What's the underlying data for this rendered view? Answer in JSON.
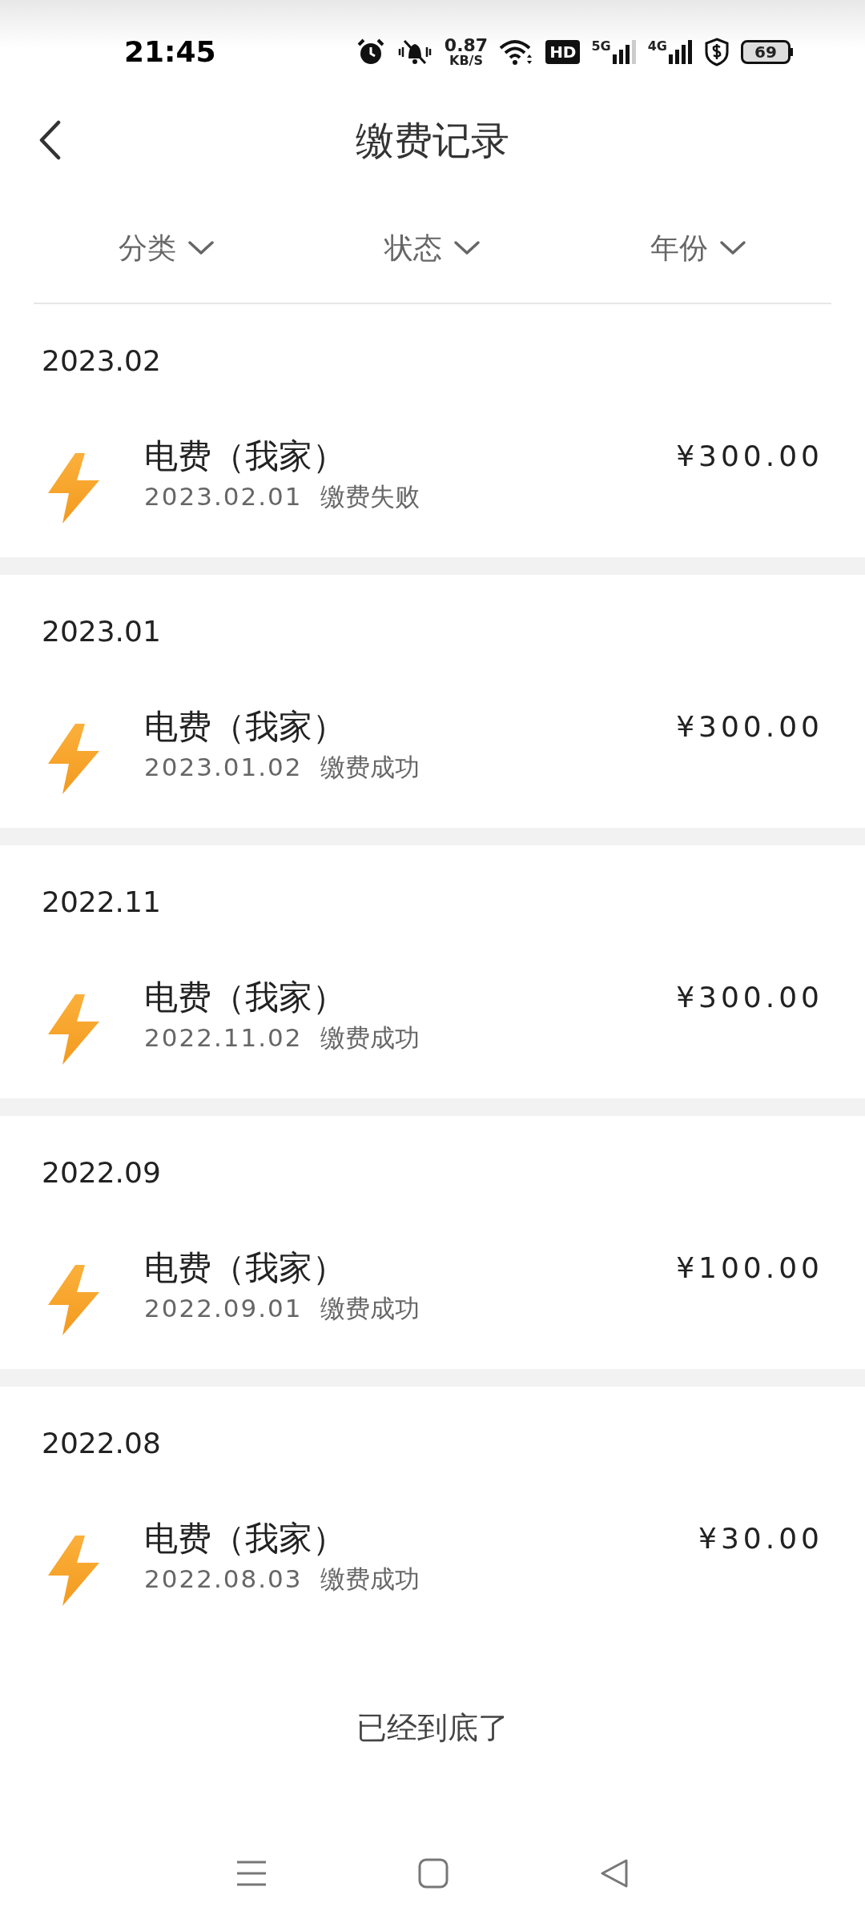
{
  "status_bar": {
    "time": "21:45",
    "speed": "0.87",
    "speed_unit": "KB/S",
    "hd": "HD",
    "net1": "5G",
    "net2": "4G",
    "battery": "69"
  },
  "header": {
    "title": "缴费记录"
  },
  "filters": [
    {
      "label": "分类"
    },
    {
      "label": "状态"
    },
    {
      "label": "年份"
    }
  ],
  "groups": [
    {
      "month": "2023.02",
      "items": [
        {
          "title": "电费（我家）",
          "date": "2023.02.01",
          "status": "缴费失败",
          "amount": "¥300.00"
        }
      ]
    },
    {
      "month": "2023.01",
      "items": [
        {
          "title": "电费（我家）",
          "date": "2023.01.02",
          "status": "缴费成功",
          "amount": "¥300.00"
        }
      ]
    },
    {
      "month": "2022.11",
      "items": [
        {
          "title": "电费（我家）",
          "date": "2022.11.02",
          "status": "缴费成功",
          "amount": "¥300.00"
        }
      ]
    },
    {
      "month": "2022.09",
      "items": [
        {
          "title": "电费（我家）",
          "date": "2022.09.01",
          "status": "缴费成功",
          "amount": "¥100.00"
        }
      ]
    },
    {
      "month": "2022.08",
      "items": [
        {
          "title": "电费（我家）",
          "date": "2022.08.03",
          "status": "缴费成功",
          "amount": "¥30.00"
        }
      ]
    }
  ],
  "end_text": "已经到底了"
}
